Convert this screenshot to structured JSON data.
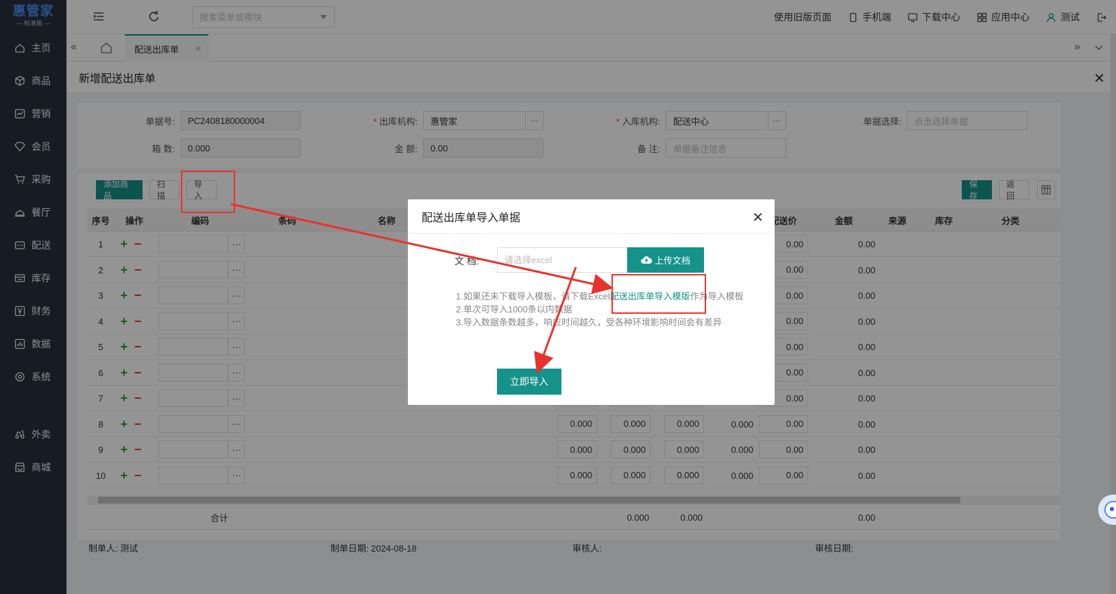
{
  "sidebar": {
    "logo": "惠管家",
    "logo_sub": "— 标准版 —",
    "items": [
      {
        "label": "主页",
        "icon": "home-icon"
      },
      {
        "label": "商品",
        "icon": "cube-icon"
      },
      {
        "label": "营销",
        "icon": "chart-line-icon"
      },
      {
        "label": "会员",
        "icon": "diamond-icon"
      },
      {
        "label": "采购",
        "icon": "cart-icon"
      },
      {
        "label": "餐厅",
        "icon": "cloche-icon"
      },
      {
        "label": "配送",
        "icon": "truck-icon"
      },
      {
        "label": "库存",
        "icon": "warehouse-icon"
      },
      {
        "label": "财务",
        "icon": "yen-icon"
      },
      {
        "label": "数据",
        "icon": "bar-chart-icon"
      },
      {
        "label": "系统",
        "icon": "settings-icon"
      },
      {
        "label": "外卖",
        "icon": "scooter-icon"
      },
      {
        "label": "商城",
        "icon": "store-icon"
      }
    ]
  },
  "topbar": {
    "search_placeholder": "搜索菜单或模块",
    "old_version": "使用旧版页面",
    "mobile": "手机端",
    "download": "下载中心",
    "apps": "应用中心",
    "user": "测试"
  },
  "tabs": {
    "active": "配送出库单"
  },
  "panel": {
    "title": "新增配送出库单"
  },
  "form": {
    "doc_no_label": "单据号:",
    "doc_no": "PC2408180000004",
    "out_org_label": "出库机构:",
    "out_org": "惠管家",
    "in_org_label": "入库机构:",
    "in_org": "配送中心",
    "select_doc_label": "单据选择:",
    "select_doc_ph": "点击选择单据",
    "boxes_label": "箱 数:",
    "boxes": "0.000",
    "amount_label": "金 额:",
    "amount": "0.00",
    "remark_label": "备 注:",
    "remark_ph": "单据备注信息",
    "required_mark": "*"
  },
  "toolbar": {
    "add": "添加商品",
    "scan": "扫描",
    "import": "导入",
    "save": "保存",
    "back": "返回"
  },
  "grid": {
    "headers": {
      "seq": "序号",
      "op": "操作",
      "code": "编码",
      "barcode": "条码",
      "name": "名称",
      "price": "配送价",
      "amount": "金额",
      "source": "来源",
      "stock": "库存",
      "category": "分类"
    },
    "rows": [
      "1",
      "2",
      "3",
      "4",
      "5",
      "6",
      "7",
      "8",
      "9",
      "10"
    ],
    "dots": "···",
    "plus": "+",
    "minus": "−",
    "zero3": "0.000",
    "zero2": "0.00",
    "total_label": "合计",
    "total_zero3": "0.000",
    "total_zero2": "0.00"
  },
  "footer": {
    "maker_label": "制单人:",
    "maker": "测试",
    "date_label": "制单日期:",
    "date": "2024-08-18",
    "auditor_label": "审核人:",
    "audit_date_label": "审核日期:"
  },
  "dialog": {
    "title": "配送出库单导入单据",
    "doc_label": "文 档:",
    "file_ph": "请选择excel",
    "upload": "上传文档",
    "note1_pre": "1.如果还未下载导入模板，请下载Excel",
    "note1_link": "配送出库单导入模版",
    "note1_post": "作为导入模板",
    "note2": "2.单次可导入1000条以内数据",
    "note3": "3.导入数据条数越多，响应时间越久，受各种环境影响时间会有差异",
    "submit": "立即导入"
  },
  "colors": {
    "accent": "#15928a",
    "sidebar": "#28313f",
    "annotation": "#e8322a"
  }
}
